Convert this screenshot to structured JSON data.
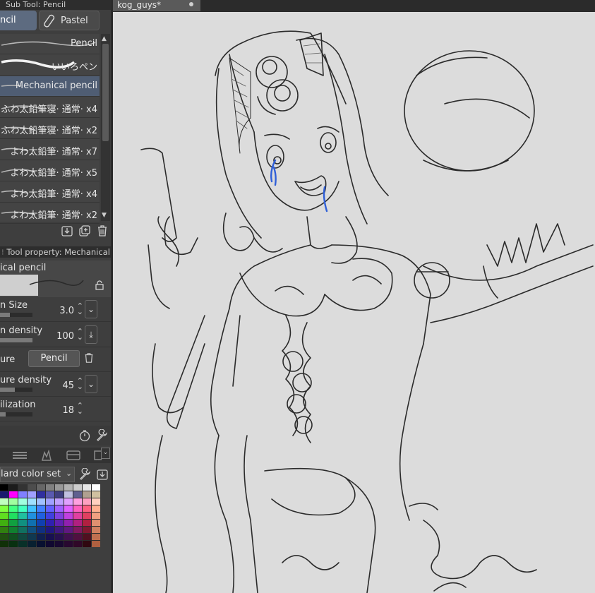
{
  "subtool_panel": {
    "title": "Sub Tool: Pencil",
    "tabs": [
      {
        "label": "ncil",
        "active": true
      },
      {
        "label": "Pastel",
        "active": false
      }
    ]
  },
  "brush_list": [
    {
      "label": "Pencil",
      "selected": false
    },
    {
      "label": "いいろペン",
      "selected": false
    },
    {
      "label": "Mechanical pencil",
      "selected": true
    },
    {
      "label": "ふわ太鉛筆寝· 通常· x4",
      "selected": false
    },
    {
      "label": "ふわ太鉛筆寝· 通常· x2",
      "selected": false
    },
    {
      "label": "よわ太鉛筆· 通常· x7",
      "selected": false
    },
    {
      "label": "よわ太鉛筆· 通常· x5",
      "selected": false
    },
    {
      "label": "よわ太鉛筆· 通常· x4",
      "selected": false
    },
    {
      "label": "よわ太鉛筆· 通常· x2",
      "selected": false
    }
  ],
  "tool_property": {
    "title": "Tool property: Mechanical p",
    "preset_name": "ical pencil",
    "rows": [
      {
        "label": "n Size",
        "value": "3.0",
        "fill": 0.3
      },
      {
        "label": "n density",
        "value": "100",
        "fill": 1.0
      },
      {
        "label": "ure",
        "button": "Pencil"
      },
      {
        "label": "ure density",
        "value": "45",
        "fill": 0.45
      },
      {
        "label": "ilization",
        "value": "18",
        "fill": 0.18
      }
    ]
  },
  "color_set": {
    "dropdown_value": "lard color set"
  },
  "document": {
    "tab_title": "kog_guys*"
  },
  "colors": {
    "accent": "#5d6b80",
    "canvas": "#dcdcdc",
    "sketch_blue": "#2f5fd8"
  }
}
